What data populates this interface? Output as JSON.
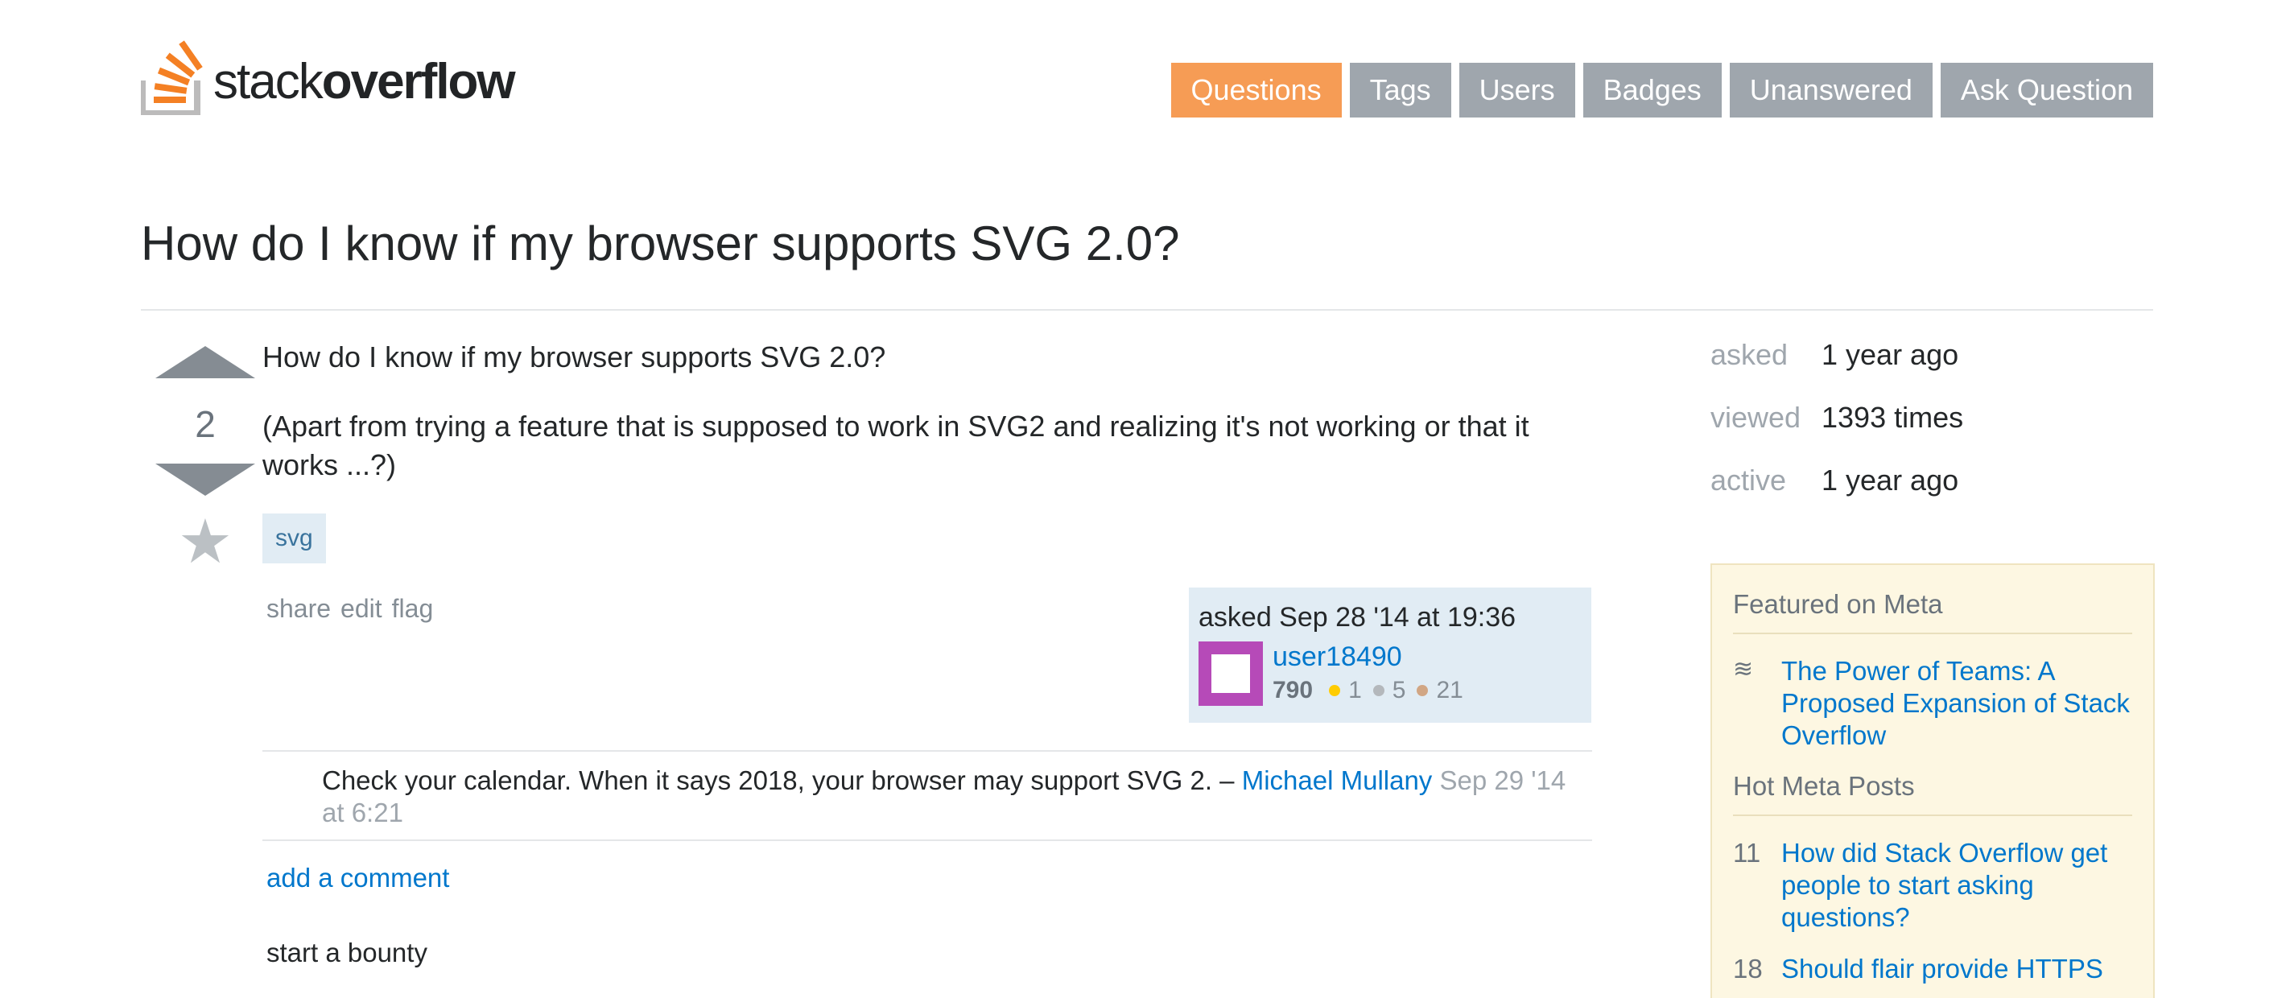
{
  "logo": {
    "text_light": "stack",
    "text_bold": "overflow"
  },
  "nav": {
    "items": [
      "Questions",
      "Tags",
      "Users",
      "Badges",
      "Unanswered",
      "Ask Question"
    ]
  },
  "question": {
    "title": "How do I know if my browser supports SVG 2.0?",
    "votes": "2",
    "body": [
      "How do I know if my browser supports SVG 2.0?",
      "(Apart from trying a feature that is supposed to work in SVG2 and realizing it's not working or that it works ...?)"
    ],
    "tag": "svg",
    "menu": [
      "share",
      "edit",
      "flag"
    ]
  },
  "owner": {
    "asked": "asked Sep 28 '14 at 19:36",
    "name": "user18490",
    "reputation": "790",
    "gold": "1",
    "silver": "5",
    "bronze": "21"
  },
  "comment": {
    "text": "Check your calendar. When it says 2018, your browser may support SVG 2. – ",
    "user": "Michael Mullany",
    "date": " Sep 29 '14 at 6:21"
  },
  "actions": {
    "add_comment": "add a comment",
    "bounty": "start a bounty"
  },
  "stats": {
    "asked_label": "asked",
    "asked_value": "1 year ago",
    "viewed_label": "viewed",
    "viewed_value": "1393 times",
    "active_label": "active",
    "active_value": "1 year ago"
  },
  "meta": {
    "featured_title": "Featured on Meta",
    "featured_link": "The Power of Teams: A Proposed Expansion of Stack Overflow",
    "hot_title": "Hot Meta Posts",
    "hot_posts": [
      {
        "count": "11",
        "title": "How did Stack Overflow get people to start asking questions?"
      },
      {
        "count": "18",
        "title": "Should flair provide HTTPS"
      }
    ]
  },
  "colors": {
    "accent": "#f69c55",
    "link": "#0077cc",
    "nav_bg": "#9fa6ad",
    "tag_bg": "#e1ecf4",
    "meta_bg": "#fdf7e2"
  }
}
